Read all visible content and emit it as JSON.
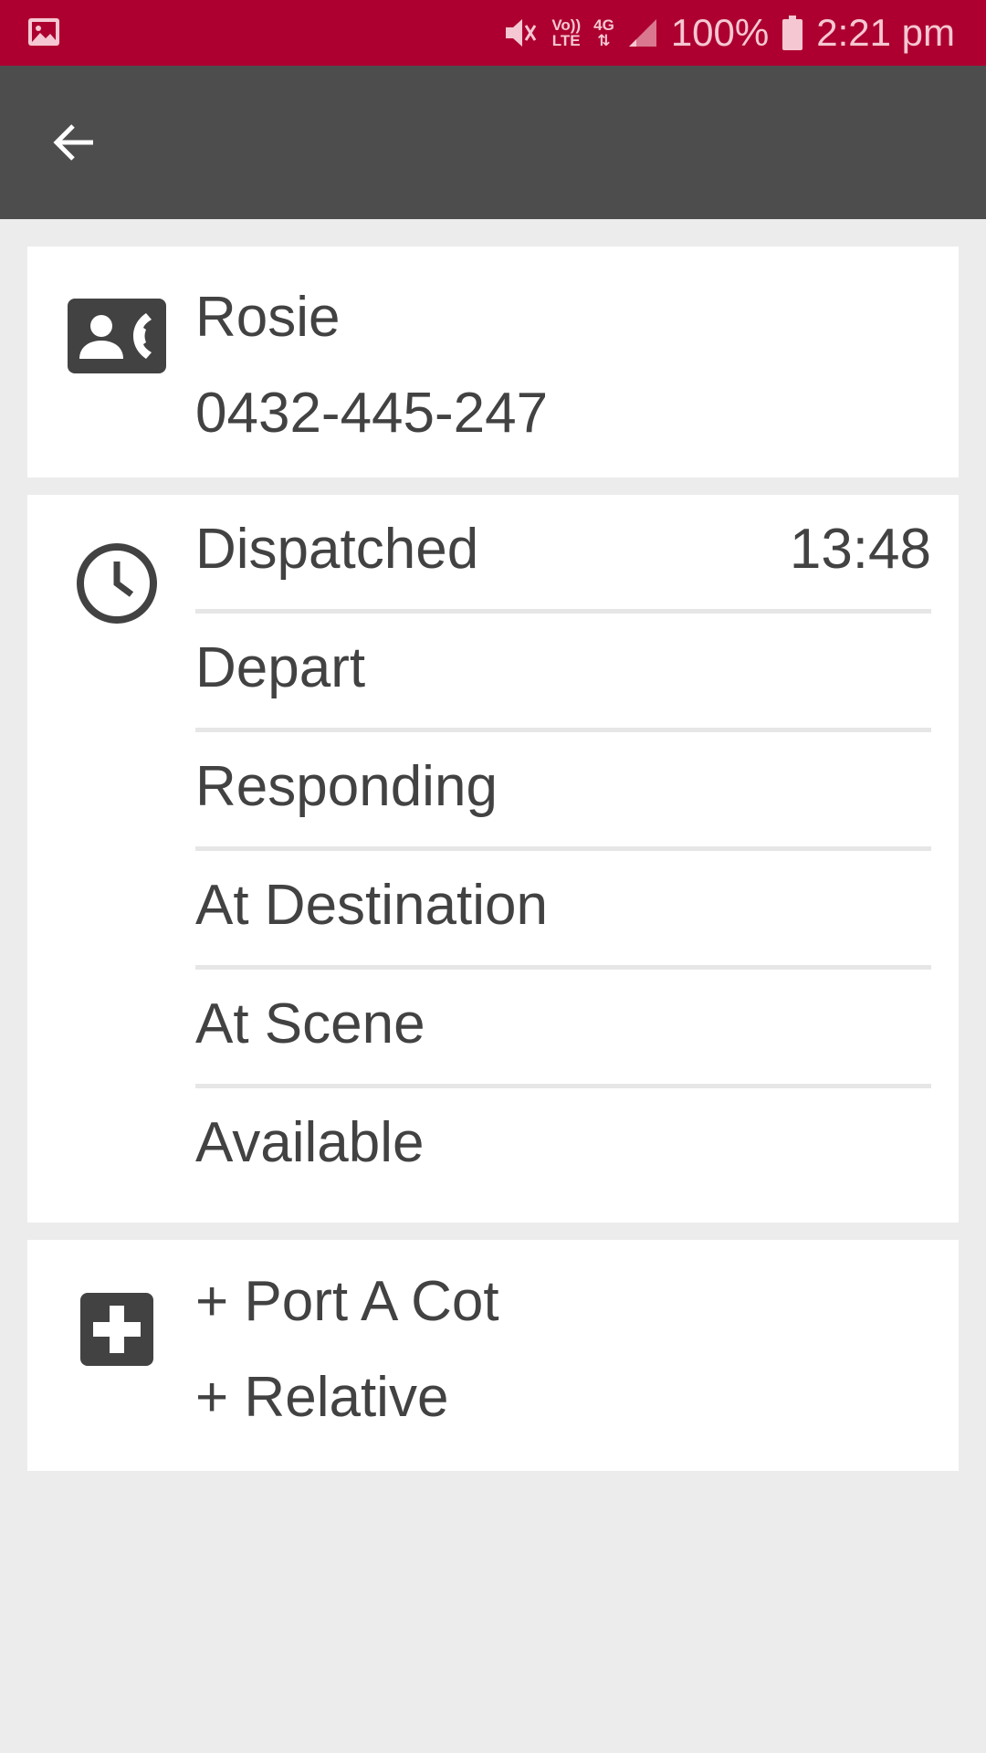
{
  "status_bar": {
    "network_type": "4G",
    "volte": "Vo))",
    "lte": "LTE",
    "battery": "100%",
    "time": "2:21 pm",
    "icons": [
      "gallery-icon",
      "mute-icon",
      "volte-icon",
      "4g-icon",
      "signal-icon",
      "battery-icon"
    ],
    "bar_color": "#ad0030"
  },
  "app_bar": {
    "back_icon": "arrow-left-icon",
    "bar_color": "#4d4d4d"
  },
  "contact": {
    "icon": "contact-phone-icon",
    "name": "Rosie",
    "phone": "0432-445-247"
  },
  "status": {
    "icon": "clock-icon",
    "rows": [
      {
        "label": "Dispatched",
        "time": "13:48"
      },
      {
        "label": "Depart",
        "time": ""
      },
      {
        "label": "Responding",
        "time": ""
      },
      {
        "label": "At Destination",
        "time": ""
      },
      {
        "label": "At Scene",
        "time": ""
      },
      {
        "label": "Available",
        "time": ""
      }
    ]
  },
  "extras": {
    "icon": "medical-plus-icon",
    "items": [
      "+ Port A Cot",
      "+ Relative"
    ]
  }
}
